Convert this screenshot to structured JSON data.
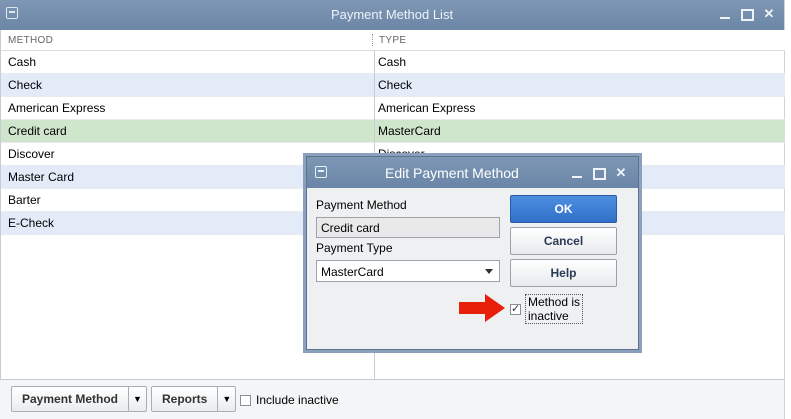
{
  "main_window": {
    "title": "Payment Method List",
    "columns": [
      "METHOD",
      "TYPE"
    ],
    "rows": [
      {
        "method": "Cash",
        "type": "Cash"
      },
      {
        "method": "Check",
        "type": "Check"
      },
      {
        "method": "American Express",
        "type": "American Express"
      },
      {
        "method": "Credit card",
        "type": "MasterCard"
      },
      {
        "method": "Discover",
        "type": "Discover"
      },
      {
        "method": "Master Card",
        "type": ""
      },
      {
        "method": "Barter",
        "type": ""
      },
      {
        "method": "E-Check",
        "type": ""
      }
    ],
    "selected_row_index": 3
  },
  "bottom_bar": {
    "payment_method_button": "Payment Method",
    "reports_button": "Reports",
    "include_inactive_label": "Include inactive",
    "include_inactive_checked": false
  },
  "dialog": {
    "title": "Edit Payment Method",
    "payment_method_label": "Payment Method",
    "payment_method_value": "Credit card",
    "payment_type_label": "Payment Type",
    "payment_type_value": "MasterCard",
    "ok_button": "OK",
    "cancel_button": "Cancel",
    "help_button": "Help",
    "inactive_label_line1": "Method is",
    "inactive_label_line2": "inactive",
    "inactive_checked": true
  },
  "colors": {
    "titlebar": "#7189a9",
    "row_alt": "#e3ebf8",
    "row_selected": "#cfe6cd",
    "ok_button": "#3a7bd5",
    "arrow": "#e8200a"
  },
  "icons": [
    "window-menu-icon",
    "minimize-icon",
    "maximize-icon",
    "close-icon",
    "dropdown-caret-icon",
    "checkbox-icon",
    "red-arrow-icon"
  ]
}
